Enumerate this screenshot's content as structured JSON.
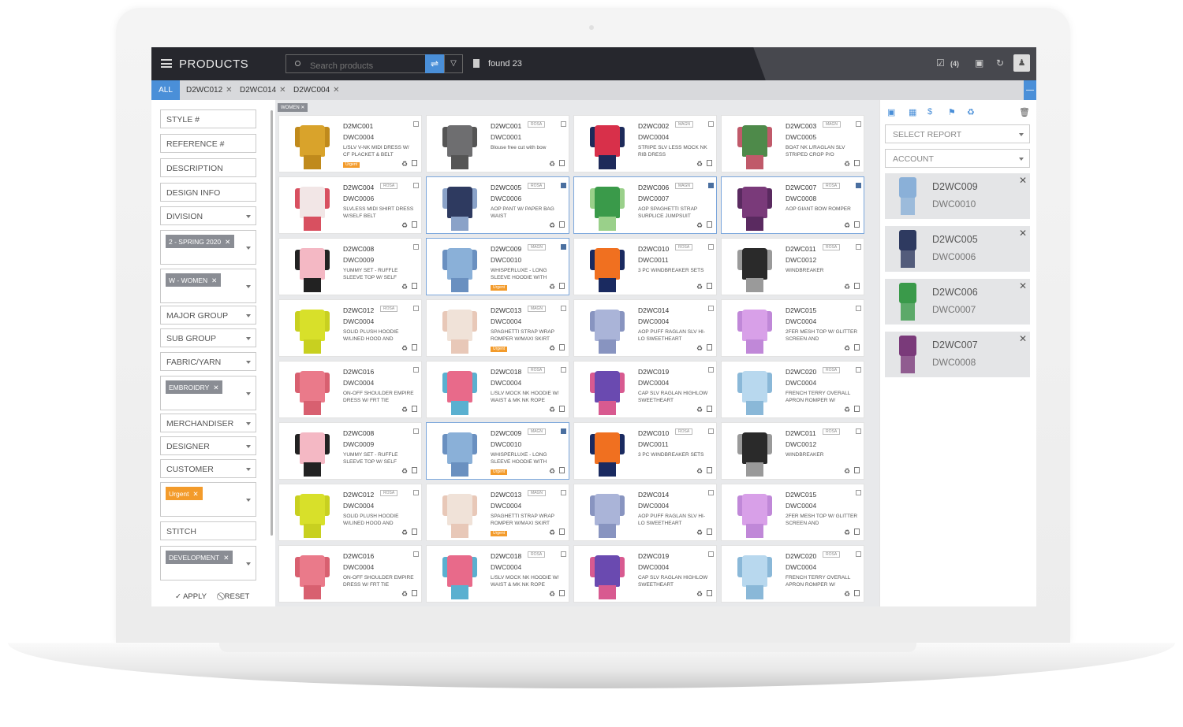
{
  "header": {
    "title": "PRODUCTS",
    "search_placeholder": "Search products",
    "found": "found 23",
    "selected_count": "(4)"
  },
  "tabs": {
    "all": "ALL",
    "items": [
      "D2WC012",
      "D2WC014",
      "D2WC004"
    ]
  },
  "filters": {
    "style": "STYLE #",
    "reference": "REFERENCE #",
    "description": "DESCRIPTION",
    "design_info": "DESIGN INFO",
    "division": "DIVISION",
    "season_chip": "2 - SPRING 2020",
    "women_chip": "W - WOMEN",
    "major_group": "MAJOR GROUP",
    "sub_group": "SUB GROUP",
    "fabric": "FABRIC/YARN",
    "embroidery_chip": "EMBROIDRY",
    "merchandiser": "MERCHANDISER",
    "designer": "DESIGNER",
    "customer": "CUSTOMER",
    "urgent_chip": "Urgent",
    "stitch": "STITCH",
    "development_chip": "DEVELOPMENT",
    "apply": "APPLY",
    "reset": "RESET"
  },
  "main": {
    "women_tag": "WOMEN"
  },
  "products": [
    {
      "code": "D2MC001",
      "ref": "DWC0004",
      "desc": "L/SLV V-NK MIDI DRESS W/ CF PLACKET & BELT",
      "badge": "",
      "urgent": "Urgent",
      "checked": false,
      "sel": false,
      "c1": "#d9a32b",
      "c2": "#c08a1c"
    },
    {
      "code": "D2WC001",
      "ref": "DWC0001",
      "desc": "Blouse free cut with bow",
      "badge": "ROSA",
      "urgent": "",
      "checked": false,
      "sel": false,
      "c1": "#6e6e70",
      "c2": "#555"
    },
    {
      "code": "D2WC002",
      "ref": "DWC0004",
      "desc": "STRIPE SLV LESS MOCK NK RIB DRESS",
      "badge": "MAGN",
      "urgent": "",
      "checked": false,
      "sel": false,
      "c1": "#d8304a",
      "c2": "#1d2a5a"
    },
    {
      "code": "D2WC003",
      "ref": "DWC0005",
      "desc": "BOAT NK L/RAGLAN SLV STRIPED CROP P/O",
      "badge": "MAGN",
      "urgent": "",
      "checked": false,
      "sel": false,
      "c1": "#4e8a4a",
      "c2": "#c05a6a"
    },
    {
      "code": "D2WC004",
      "ref": "DWC0006",
      "desc": "SLVLESS MIDI SHIRT DRESS W/SELF BELT",
      "badge": "ROSA",
      "urgent": "",
      "checked": false,
      "sel": false,
      "c1": "#f2e6e6",
      "c2": "#d85060"
    },
    {
      "code": "D2WC005",
      "ref": "DWC0006",
      "desc": "AOP PANT W/ PAPER BAG WAIST",
      "badge": "ROSA",
      "urgent": "",
      "checked": true,
      "sel": true,
      "c1": "#2e3a60",
      "c2": "#8aa2c8"
    },
    {
      "code": "D2WC006",
      "ref": "DWC0007",
      "desc": "AOP SPAGHETTI STRAP SURPLICE JUMPSUIT",
      "badge": "MAGN",
      "urgent": "",
      "checked": true,
      "sel": true,
      "c1": "#3a9a4a",
      "c2": "#9ad08a"
    },
    {
      "code": "D2WC007",
      "ref": "DWC0008",
      "desc": "AOP GIANT BOW ROMPER",
      "badge": "ROSA",
      "urgent": "",
      "checked": true,
      "sel": true,
      "c1": "#7a3a7a",
      "c2": "#5a2a60"
    },
    {
      "code": "D2WC008",
      "ref": "DWC0009",
      "desc": "YUMMY SET - RUFFLE SLEEVE TOP W/ SELF",
      "badge": "",
      "urgent": "",
      "checked": false,
      "sel": false,
      "c1": "#f4b8c4",
      "c2": "#222"
    },
    {
      "code": "D2WC009",
      "ref": "DWC0010",
      "desc": "WHISPERLUXE - LONG SLEEVE HOODIE WITH",
      "badge": "MAGN",
      "urgent": "Urgent",
      "checked": true,
      "sel": true,
      "c1": "#8ab0d8",
      "c2": "#6a90c0"
    },
    {
      "code": "D2WC010",
      "ref": "DWC0011",
      "desc": "3 PC WINDBREAKER SETS",
      "badge": "ROSA",
      "urgent": "",
      "checked": false,
      "sel": false,
      "c1": "#f07020",
      "c2": "#1a2a60"
    },
    {
      "code": "D2WC011",
      "ref": "DWC0012",
      "desc": "WINDBREAKER",
      "badge": "ROSA",
      "urgent": "",
      "checked": false,
      "sel": false,
      "c1": "#2a2a2a",
      "c2": "#9a9a9a"
    },
    {
      "code": "D2WC012",
      "ref": "DWC0004",
      "desc": "SOLID PLUSH HOODIE W/LINED HOOD AND",
      "badge": "ROSA",
      "urgent": "",
      "checked": false,
      "sel": false,
      "c1": "#d8e02a",
      "c2": "#c8d020"
    },
    {
      "code": "D2WC013",
      "ref": "DWC0004",
      "desc": "SPAGHETTI STRAP WRAP ROMPER W/MAXI SKIRT",
      "badge": "MAGN",
      "urgent": "Urgent",
      "checked": false,
      "sel": false,
      "c1": "#f0e2d8",
      "c2": "#e8c8b8"
    },
    {
      "code": "D2WC014",
      "ref": "DWC0004",
      "desc": "AOP PUFF RAGLAN SLV HI-LO SWEETHEART",
      "badge": "",
      "urgent": "",
      "checked": false,
      "sel": false,
      "c1": "#aab4d8",
      "c2": "#8894c0"
    },
    {
      "code": "D2WC015",
      "ref": "DWC0004",
      "desc": "2FER MESH TOP W/ GLITTER SCREEN AND",
      "badge": "",
      "urgent": "",
      "checked": false,
      "sel": false,
      "c1": "#d8a0e8",
      "c2": "#c088d8"
    },
    {
      "code": "D2WC016",
      "ref": "DWC0004",
      "desc": "ON-OFF SHOULDER EMPIRE DRESS W/ FRT TIE",
      "badge": "",
      "urgent": "",
      "checked": false,
      "sel": false,
      "c1": "#ea7a8a",
      "c2": "#d86070"
    },
    {
      "code": "D2WC018",
      "ref": "DWC0004",
      "desc": "L/SLV MOCK NK HOODIE W/ WAIST & MK NK ROPE",
      "badge": "ROSA",
      "urgent": "",
      "checked": false,
      "sel": false,
      "c1": "#e86a8a",
      "c2": "#5ab0d0"
    },
    {
      "code": "D2WC019",
      "ref": "DWC0004",
      "desc": "CAP SLV RAGLAN HIGHLOW SWEETHEART",
      "badge": "",
      "urgent": "",
      "checked": false,
      "sel": false,
      "c1": "#6a4ab0",
      "c2": "#d85a90"
    },
    {
      "code": "D2WC020",
      "ref": "DWC0004",
      "desc": "FRENCH TERRY OVERALL APRON ROMPER W/",
      "badge": "ROSA",
      "urgent": "",
      "checked": false,
      "sel": false,
      "c1": "#b8d8ee",
      "c2": "#8ab8d8"
    },
    {
      "code": "D2WC008",
      "ref": "DWC0009",
      "desc": "YUMMY SET - RUFFLE SLEEVE TOP W/ SELF",
      "badge": "",
      "urgent": "",
      "checked": false,
      "sel": false,
      "c1": "#f4b8c4",
      "c2": "#222"
    },
    {
      "code": "D2WC009",
      "ref": "DWC0010",
      "desc": "WHISPERLUXE - LONG SLEEVE HOODIE WITH",
      "badge": "MAGN",
      "urgent": "Urgent",
      "checked": true,
      "sel": true,
      "c1": "#8ab0d8",
      "c2": "#6a90c0"
    },
    {
      "code": "D2WC010",
      "ref": "DWC0011",
      "desc": "3 PC WINDBREAKER SETS",
      "badge": "ROSA",
      "urgent": "",
      "checked": false,
      "sel": false,
      "c1": "#f07020",
      "c2": "#1a2a60"
    },
    {
      "code": "D2WC011",
      "ref": "DWC0012",
      "desc": "WINDBREAKER",
      "badge": "ROSA",
      "urgent": "",
      "checked": false,
      "sel": false,
      "c1": "#2a2a2a",
      "c2": "#9a9a9a"
    },
    {
      "code": "D2WC012",
      "ref": "DWC0004",
      "desc": "SOLID PLUSH HOODIE W/LINED HOOD AND",
      "badge": "ROSA",
      "urgent": "",
      "checked": false,
      "sel": false,
      "c1": "#d8e02a",
      "c2": "#c8d020"
    },
    {
      "code": "D2WC013",
      "ref": "DWC0004",
      "desc": "SPAGHETTI STRAP WRAP ROMPER W/MAXI SKIRT",
      "badge": "MAGN",
      "urgent": "Urgent",
      "checked": false,
      "sel": false,
      "c1": "#f0e2d8",
      "c2": "#e8c8b8"
    },
    {
      "code": "D2WC014",
      "ref": "DWC0004",
      "desc": "AOP PUFF RAGLAN SLV HI-LO SWEETHEART",
      "badge": "",
      "urgent": "",
      "checked": false,
      "sel": false,
      "c1": "#aab4d8",
      "c2": "#8894c0"
    },
    {
      "code": "D2WC015",
      "ref": "DWC0004",
      "desc": "2FER MESH TOP W/ GLITTER SCREEN AND",
      "badge": "",
      "urgent": "",
      "checked": false,
      "sel": false,
      "c1": "#d8a0e8",
      "c2": "#c088d8"
    },
    {
      "code": "D2WC016",
      "ref": "DWC0004",
      "desc": "ON-OFF SHOULDER EMPIRE DRESS W/ FRT TIE",
      "badge": "",
      "urgent": "",
      "checked": false,
      "sel": false,
      "c1": "#ea7a8a",
      "c2": "#d86070"
    },
    {
      "code": "D2WC018",
      "ref": "DWC0004",
      "desc": "L/SLV MOCK NK HOODIE W/ WAIST & MK NK ROPE",
      "badge": "ROSA",
      "urgent": "",
      "checked": false,
      "sel": false,
      "c1": "#e86a8a",
      "c2": "#5ab0d0"
    },
    {
      "code": "D2WC019",
      "ref": "DWC0004",
      "desc": "CAP SLV RAGLAN HIGHLOW SWEETHEART",
      "badge": "",
      "urgent": "",
      "checked": false,
      "sel": false,
      "c1": "#6a4ab0",
      "c2": "#d85a90"
    },
    {
      "code": "D2WC020",
      "ref": "DWC0004",
      "desc": "FRENCH TERRY OVERALL APRON ROMPER W/",
      "badge": "ROSA",
      "urgent": "",
      "checked": false,
      "sel": false,
      "c1": "#b8d8ee",
      "c2": "#8ab8d8"
    }
  ],
  "report": {
    "select_report": "SELECT REPORT",
    "account": "ACCOUNT"
  },
  "selected": [
    {
      "code": "D2WC009",
      "ref": "DWC0010",
      "c1": "#8ab0d8"
    },
    {
      "code": "D2WC005",
      "ref": "DWC0006",
      "c1": "#2e3a60"
    },
    {
      "code": "D2WC006",
      "ref": "DWC0007",
      "c1": "#3a9a4a"
    },
    {
      "code": "D2WC007",
      "ref": "DWC0008",
      "c1": "#7a3a7a"
    }
  ]
}
